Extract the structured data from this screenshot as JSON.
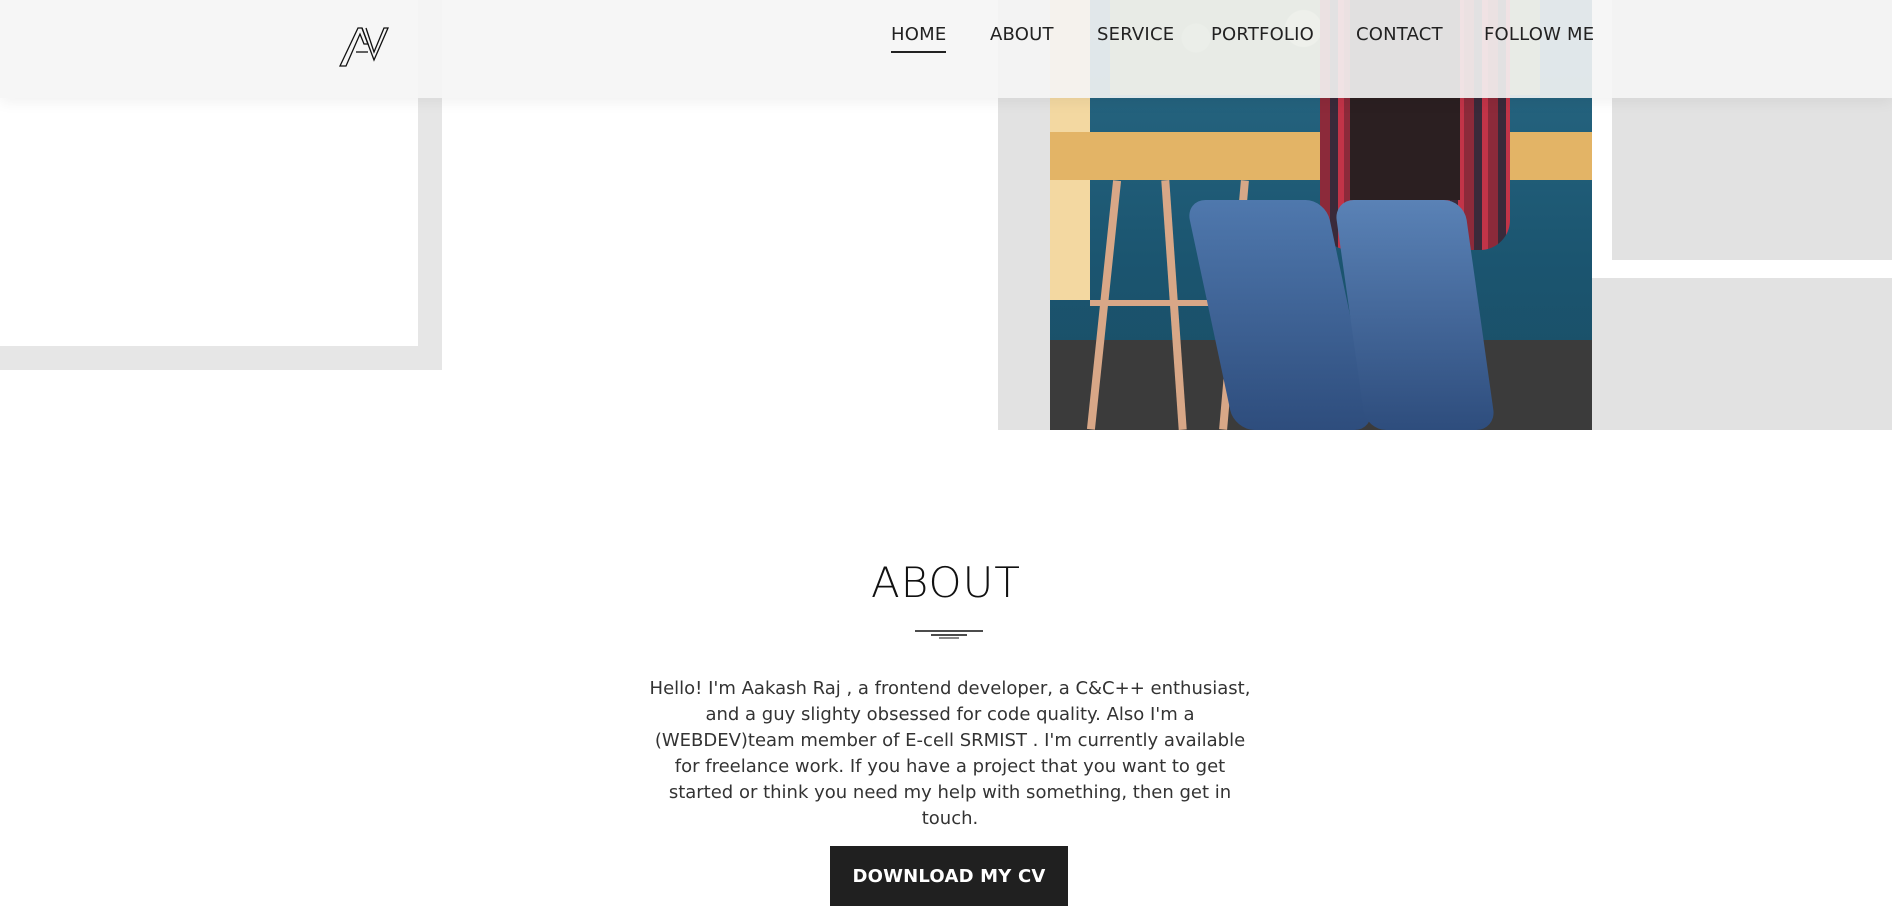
{
  "header": {
    "logo_text": "AV",
    "nav": [
      {
        "label": "HOME",
        "active": true
      },
      {
        "label": "ABOUT",
        "active": false
      },
      {
        "label": "SERVICE",
        "active": false
      },
      {
        "label": "PORTFOLIO",
        "active": false
      },
      {
        "label": "CONTACT",
        "active": false
      },
      {
        "label": "FOLLOW ME",
        "active": false
      }
    ]
  },
  "about": {
    "title": "ABOUT",
    "text": "Hello! I'm Aakash Raj , a frontend developer, a C&C++ enthusiast, and a guy slighty obsessed for code quality. Also I'm a (WEBDEV)team member of E-cell SRMIST . I'm currently available for freelance work. If you have a project that you want to get started or think you need my help with something, then get in touch.",
    "button_label": "DOWNLOAD MY CV"
  },
  "colors": {
    "header_bg": "#f5f5f5",
    "text": "#222222",
    "button_bg": "#202020",
    "decor_gray": "#e2e2e2"
  }
}
